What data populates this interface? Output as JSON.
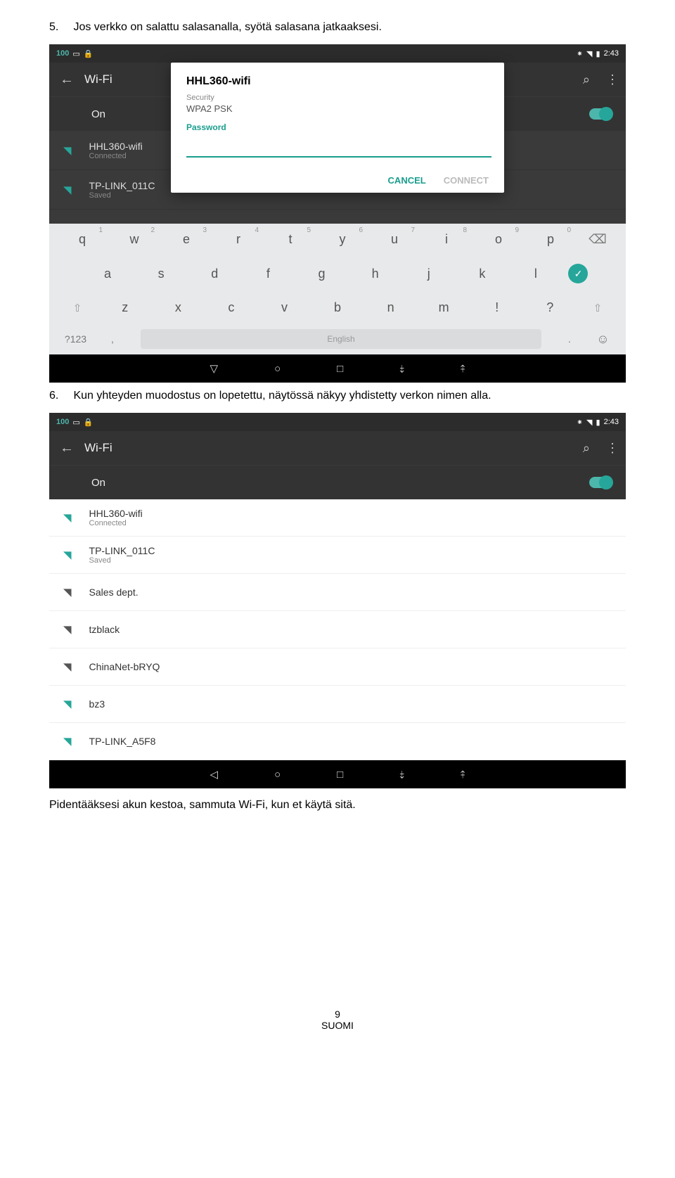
{
  "step5": {
    "num": "5.",
    "text": "Jos verkko on salattu salasanalla, syötä salasana jatkaaksesi."
  },
  "step6": {
    "num": "6.",
    "text": "Kun yhteyden muodostus on lopetettu, näytössä näkyy yhdistetty verkon nimen alla."
  },
  "statusbar": {
    "level": "100",
    "time": "2:43"
  },
  "appbar": {
    "title": "Wi‑Fi"
  },
  "on_row": {
    "label": "On"
  },
  "dialog": {
    "title": "HHL360-wifi",
    "sec_label": "Security",
    "sec_value": "WPA2 PSK",
    "pw_label": "Password",
    "cancel": "CANCEL",
    "connect": "CONNECT"
  },
  "shot1_nets": [
    {
      "name": "HHL360-wifi",
      "sub": "Connected"
    },
    {
      "name": "TP-LINK_011C",
      "sub": "Saved"
    }
  ],
  "keyboard": {
    "row1": [
      {
        "k": "q",
        "n": "1"
      },
      {
        "k": "w",
        "n": "2"
      },
      {
        "k": "e",
        "n": "3"
      },
      {
        "k": "r",
        "n": "4"
      },
      {
        "k": "t",
        "n": "5"
      },
      {
        "k": "y",
        "n": "6"
      },
      {
        "k": "u",
        "n": "7"
      },
      {
        "k": "i",
        "n": "8"
      },
      {
        "k": "o",
        "n": "9"
      },
      {
        "k": "p",
        "n": "0"
      }
    ],
    "row2": [
      "a",
      "s",
      "d",
      "f",
      "g",
      "h",
      "j",
      "k",
      "l"
    ],
    "row3": [
      "z",
      "x",
      "c",
      "v",
      "b",
      "n",
      "m",
      "!",
      "?"
    ],
    "sym": "?123",
    "space": "English",
    "comma": ",",
    "dot": "."
  },
  "shot2_nets": [
    {
      "name": "HHL360-wifi",
      "sub": "Connected",
      "ico": "teal"
    },
    {
      "name": "TP-LINK_011C",
      "sub": "Saved",
      "ico": "teal"
    },
    {
      "name": "Sales dept.",
      "sub": "",
      "ico": "dark"
    },
    {
      "name": "tzblack",
      "sub": "",
      "ico": "dark"
    },
    {
      "name": "ChinaNet-bRYQ",
      "sub": "",
      "ico": "dark"
    },
    {
      "name": "bz3",
      "sub": "",
      "ico": "teal"
    },
    {
      "name": "TP-LINK_A5F8",
      "sub": "",
      "ico": "teal"
    }
  ],
  "footer": "Pidentääksesi akun kestoa, sammuta Wi-Fi, kun et käytä sitä.",
  "page": {
    "num": "9",
    "lang": "SUOMI"
  }
}
